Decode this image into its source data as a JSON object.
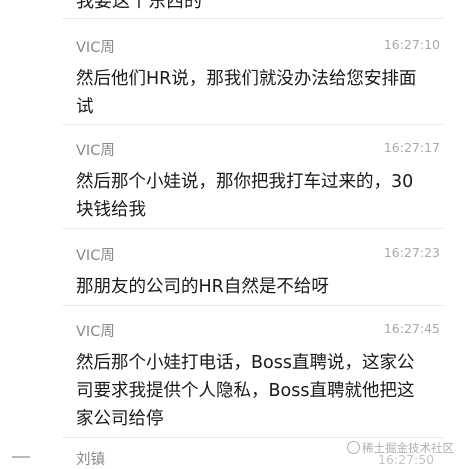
{
  "top_partial_text": "我要这个东西的",
  "messages": [
    {
      "sender": "VIC周",
      "time": "16:27:10",
      "text": "然后他们HR说，那我们就没办法给您安排面试"
    },
    {
      "sender": "VIC周",
      "time": "16:27:17",
      "text": "然后那个小娃说，那你把我打车过来的，30块钱给我"
    },
    {
      "sender": "VIC周",
      "time": "16:27:23",
      "text": "那朋友的公司的HR自然是不给呀"
    },
    {
      "sender": "VIC周",
      "time": "16:27:45",
      "text": "然后那个小娃打电话，Boss直聘说，这家公司要求我提供个人隐私，Boss直聘就他把这家公司给停"
    }
  ],
  "next_message": {
    "sender": "刘镇",
    "time": "16:27:50"
  },
  "watermark": "稀土掘金技术社区",
  "colors": {
    "background": "#ffffff",
    "sender_text": "#8a8a8a",
    "time_text": "#a9a9a9",
    "message_text": "#1a1a1a",
    "divider": "#ececec"
  }
}
